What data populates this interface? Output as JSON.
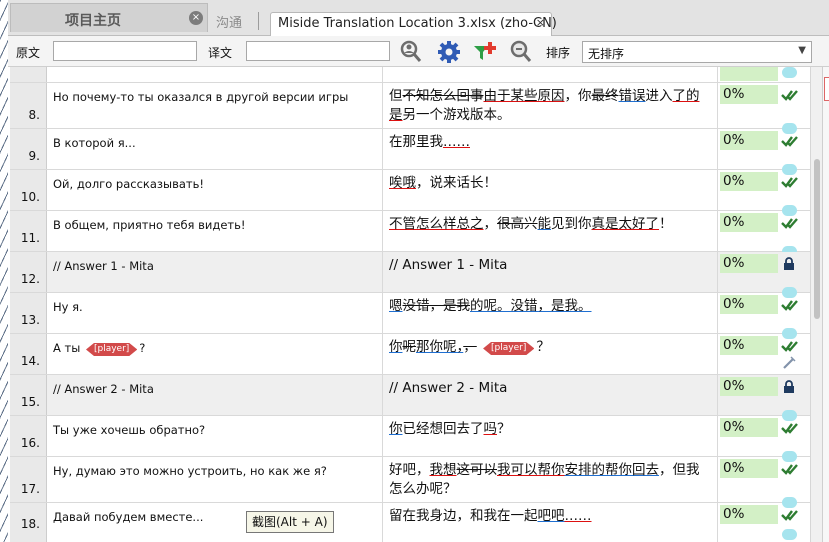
{
  "tabs": {
    "home_title": "项目主页",
    "comm_title": "沟通",
    "file_title": "Miside Translation Location 3.xlsx (zho-CN)",
    "close_glyph": "×"
  },
  "toolbar": {
    "source_label": "原文",
    "target_label": "译文",
    "sort_label": "排序",
    "sort_value": "无排序",
    "icons": [
      "search-person-icon",
      "gear-icon",
      "filter-add-icon",
      "zoom-icon"
    ]
  },
  "rows": [
    {
      "num": "8.",
      "source": "Но почему-то ты оказался в другой версии игры",
      "pct": "0%",
      "status": "check"
    },
    {
      "num": "9.",
      "source": "В которой я...",
      "pct": "0%",
      "status": "check"
    },
    {
      "num": "10.",
      "source": "Ой, долго рассказывать!",
      "pct": "0%",
      "status": "check"
    },
    {
      "num": "11.",
      "source": "В общем, приятно тебя видеть!",
      "pct": "0%",
      "status": "check"
    },
    {
      "num": "12.",
      "source": "// Answer 1 - Mita",
      "target": "// Answer 1 - Mita",
      "pct": "0%",
      "status": "lock"
    },
    {
      "num": "13.",
      "source": "Ну я.",
      "pct": "0%",
      "status": "check"
    },
    {
      "num": "14.",
      "source": "А ты",
      "source_tag": "[player]",
      "source_end": "?",
      "pct": "0%",
      "status": "check"
    },
    {
      "num": "15.",
      "source": "// Answer 2 - Mita",
      "target": "// Answer 2 - Mita",
      "pct": "0%",
      "status": "lock"
    },
    {
      "num": "16.",
      "source": "Ты уже хочешь обратно?",
      "pct": "0%",
      "status": "check"
    },
    {
      "num": "17.",
      "source": "Ну, думаю это можно устроить, но как же я?",
      "pct": "0%",
      "status": "check"
    },
    {
      "num": "18.",
      "source": "Давай побудем вместе...",
      "pct": "0%",
      "status": "check"
    }
  ],
  "targets": {
    "r8": [
      "但",
      "不知怎么回事",
      "由于",
      "某些",
      "原因",
      "，你",
      "最终",
      "错误",
      "进入",
      "了的",
      "是",
      "另一个游戏版本。"
    ],
    "r9": [
      "在那里我",
      "……"
    ],
    "r10": [
      "唉哦",
      "，说来话长！"
    ],
    "r11": [
      "不管怎么样",
      "总之",
      "，",
      "很高兴",
      "能",
      "见到你",
      "真是太好了",
      "！"
    ],
    "r13": [
      "嗯",
      "没错，是我",
      "的呢。没错，是我。"
    ],
    "r14": [
      "你",
      "呢",
      "那你呢，",
      "，",
      "[player]",
      "？"
    ],
    "r16": [
      "你",
      "已经想回去了",
      "吗",
      "？"
    ],
    "r17": [
      "好吧，",
      "我想",
      "这可以",
      "我可以帮你",
      "安排的",
      "帮你回去",
      "，",
      "但我怎么办呢？"
    ],
    "r18": [
      "留在我身边，和我在一起",
      "吧吧",
      "……"
    ]
  },
  "tooltip": "截图(Alt + A)",
  "colors": {
    "pct_bar": "#d3f0c6",
    "check": "#2e7d32",
    "bubble": "#a6e4ee",
    "red_edit": "#d11111",
    "blue_edit": "#1f6fd1",
    "tag": "#d24a4a"
  }
}
